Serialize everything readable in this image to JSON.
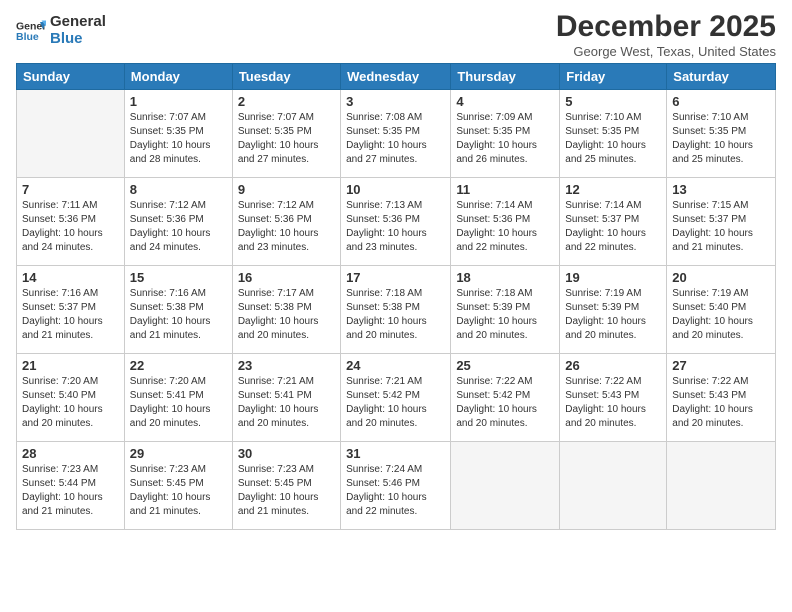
{
  "header": {
    "logo_line1": "General",
    "logo_line2": "Blue",
    "month": "December 2025",
    "location": "George West, Texas, United States"
  },
  "weekdays": [
    "Sunday",
    "Monday",
    "Tuesday",
    "Wednesday",
    "Thursday",
    "Friday",
    "Saturday"
  ],
  "weeks": [
    [
      {
        "day": "",
        "info": ""
      },
      {
        "day": "1",
        "info": "Sunrise: 7:07 AM\nSunset: 5:35 PM\nDaylight: 10 hours\nand 28 minutes."
      },
      {
        "day": "2",
        "info": "Sunrise: 7:07 AM\nSunset: 5:35 PM\nDaylight: 10 hours\nand 27 minutes."
      },
      {
        "day": "3",
        "info": "Sunrise: 7:08 AM\nSunset: 5:35 PM\nDaylight: 10 hours\nand 27 minutes."
      },
      {
        "day": "4",
        "info": "Sunrise: 7:09 AM\nSunset: 5:35 PM\nDaylight: 10 hours\nand 26 minutes."
      },
      {
        "day": "5",
        "info": "Sunrise: 7:10 AM\nSunset: 5:35 PM\nDaylight: 10 hours\nand 25 minutes."
      },
      {
        "day": "6",
        "info": "Sunrise: 7:10 AM\nSunset: 5:35 PM\nDaylight: 10 hours\nand 25 minutes."
      }
    ],
    [
      {
        "day": "7",
        "info": "Sunrise: 7:11 AM\nSunset: 5:36 PM\nDaylight: 10 hours\nand 24 minutes."
      },
      {
        "day": "8",
        "info": "Sunrise: 7:12 AM\nSunset: 5:36 PM\nDaylight: 10 hours\nand 24 minutes."
      },
      {
        "day": "9",
        "info": "Sunrise: 7:12 AM\nSunset: 5:36 PM\nDaylight: 10 hours\nand 23 minutes."
      },
      {
        "day": "10",
        "info": "Sunrise: 7:13 AM\nSunset: 5:36 PM\nDaylight: 10 hours\nand 23 minutes."
      },
      {
        "day": "11",
        "info": "Sunrise: 7:14 AM\nSunset: 5:36 PM\nDaylight: 10 hours\nand 22 minutes."
      },
      {
        "day": "12",
        "info": "Sunrise: 7:14 AM\nSunset: 5:37 PM\nDaylight: 10 hours\nand 22 minutes."
      },
      {
        "day": "13",
        "info": "Sunrise: 7:15 AM\nSunset: 5:37 PM\nDaylight: 10 hours\nand 21 minutes."
      }
    ],
    [
      {
        "day": "14",
        "info": "Sunrise: 7:16 AM\nSunset: 5:37 PM\nDaylight: 10 hours\nand 21 minutes."
      },
      {
        "day": "15",
        "info": "Sunrise: 7:16 AM\nSunset: 5:38 PM\nDaylight: 10 hours\nand 21 minutes."
      },
      {
        "day": "16",
        "info": "Sunrise: 7:17 AM\nSunset: 5:38 PM\nDaylight: 10 hours\nand 20 minutes."
      },
      {
        "day": "17",
        "info": "Sunrise: 7:18 AM\nSunset: 5:38 PM\nDaylight: 10 hours\nand 20 minutes."
      },
      {
        "day": "18",
        "info": "Sunrise: 7:18 AM\nSunset: 5:39 PM\nDaylight: 10 hours\nand 20 minutes."
      },
      {
        "day": "19",
        "info": "Sunrise: 7:19 AM\nSunset: 5:39 PM\nDaylight: 10 hours\nand 20 minutes."
      },
      {
        "day": "20",
        "info": "Sunrise: 7:19 AM\nSunset: 5:40 PM\nDaylight: 10 hours\nand 20 minutes."
      }
    ],
    [
      {
        "day": "21",
        "info": "Sunrise: 7:20 AM\nSunset: 5:40 PM\nDaylight: 10 hours\nand 20 minutes."
      },
      {
        "day": "22",
        "info": "Sunrise: 7:20 AM\nSunset: 5:41 PM\nDaylight: 10 hours\nand 20 minutes."
      },
      {
        "day": "23",
        "info": "Sunrise: 7:21 AM\nSunset: 5:41 PM\nDaylight: 10 hours\nand 20 minutes."
      },
      {
        "day": "24",
        "info": "Sunrise: 7:21 AM\nSunset: 5:42 PM\nDaylight: 10 hours\nand 20 minutes."
      },
      {
        "day": "25",
        "info": "Sunrise: 7:22 AM\nSunset: 5:42 PM\nDaylight: 10 hours\nand 20 minutes."
      },
      {
        "day": "26",
        "info": "Sunrise: 7:22 AM\nSunset: 5:43 PM\nDaylight: 10 hours\nand 20 minutes."
      },
      {
        "day": "27",
        "info": "Sunrise: 7:22 AM\nSunset: 5:43 PM\nDaylight: 10 hours\nand 20 minutes."
      }
    ],
    [
      {
        "day": "28",
        "info": "Sunrise: 7:23 AM\nSunset: 5:44 PM\nDaylight: 10 hours\nand 21 minutes."
      },
      {
        "day": "29",
        "info": "Sunrise: 7:23 AM\nSunset: 5:45 PM\nDaylight: 10 hours\nand 21 minutes."
      },
      {
        "day": "30",
        "info": "Sunrise: 7:23 AM\nSunset: 5:45 PM\nDaylight: 10 hours\nand 21 minutes."
      },
      {
        "day": "31",
        "info": "Sunrise: 7:24 AM\nSunset: 5:46 PM\nDaylight: 10 hours\nand 22 minutes."
      },
      {
        "day": "",
        "info": ""
      },
      {
        "day": "",
        "info": ""
      },
      {
        "day": "",
        "info": ""
      }
    ]
  ]
}
